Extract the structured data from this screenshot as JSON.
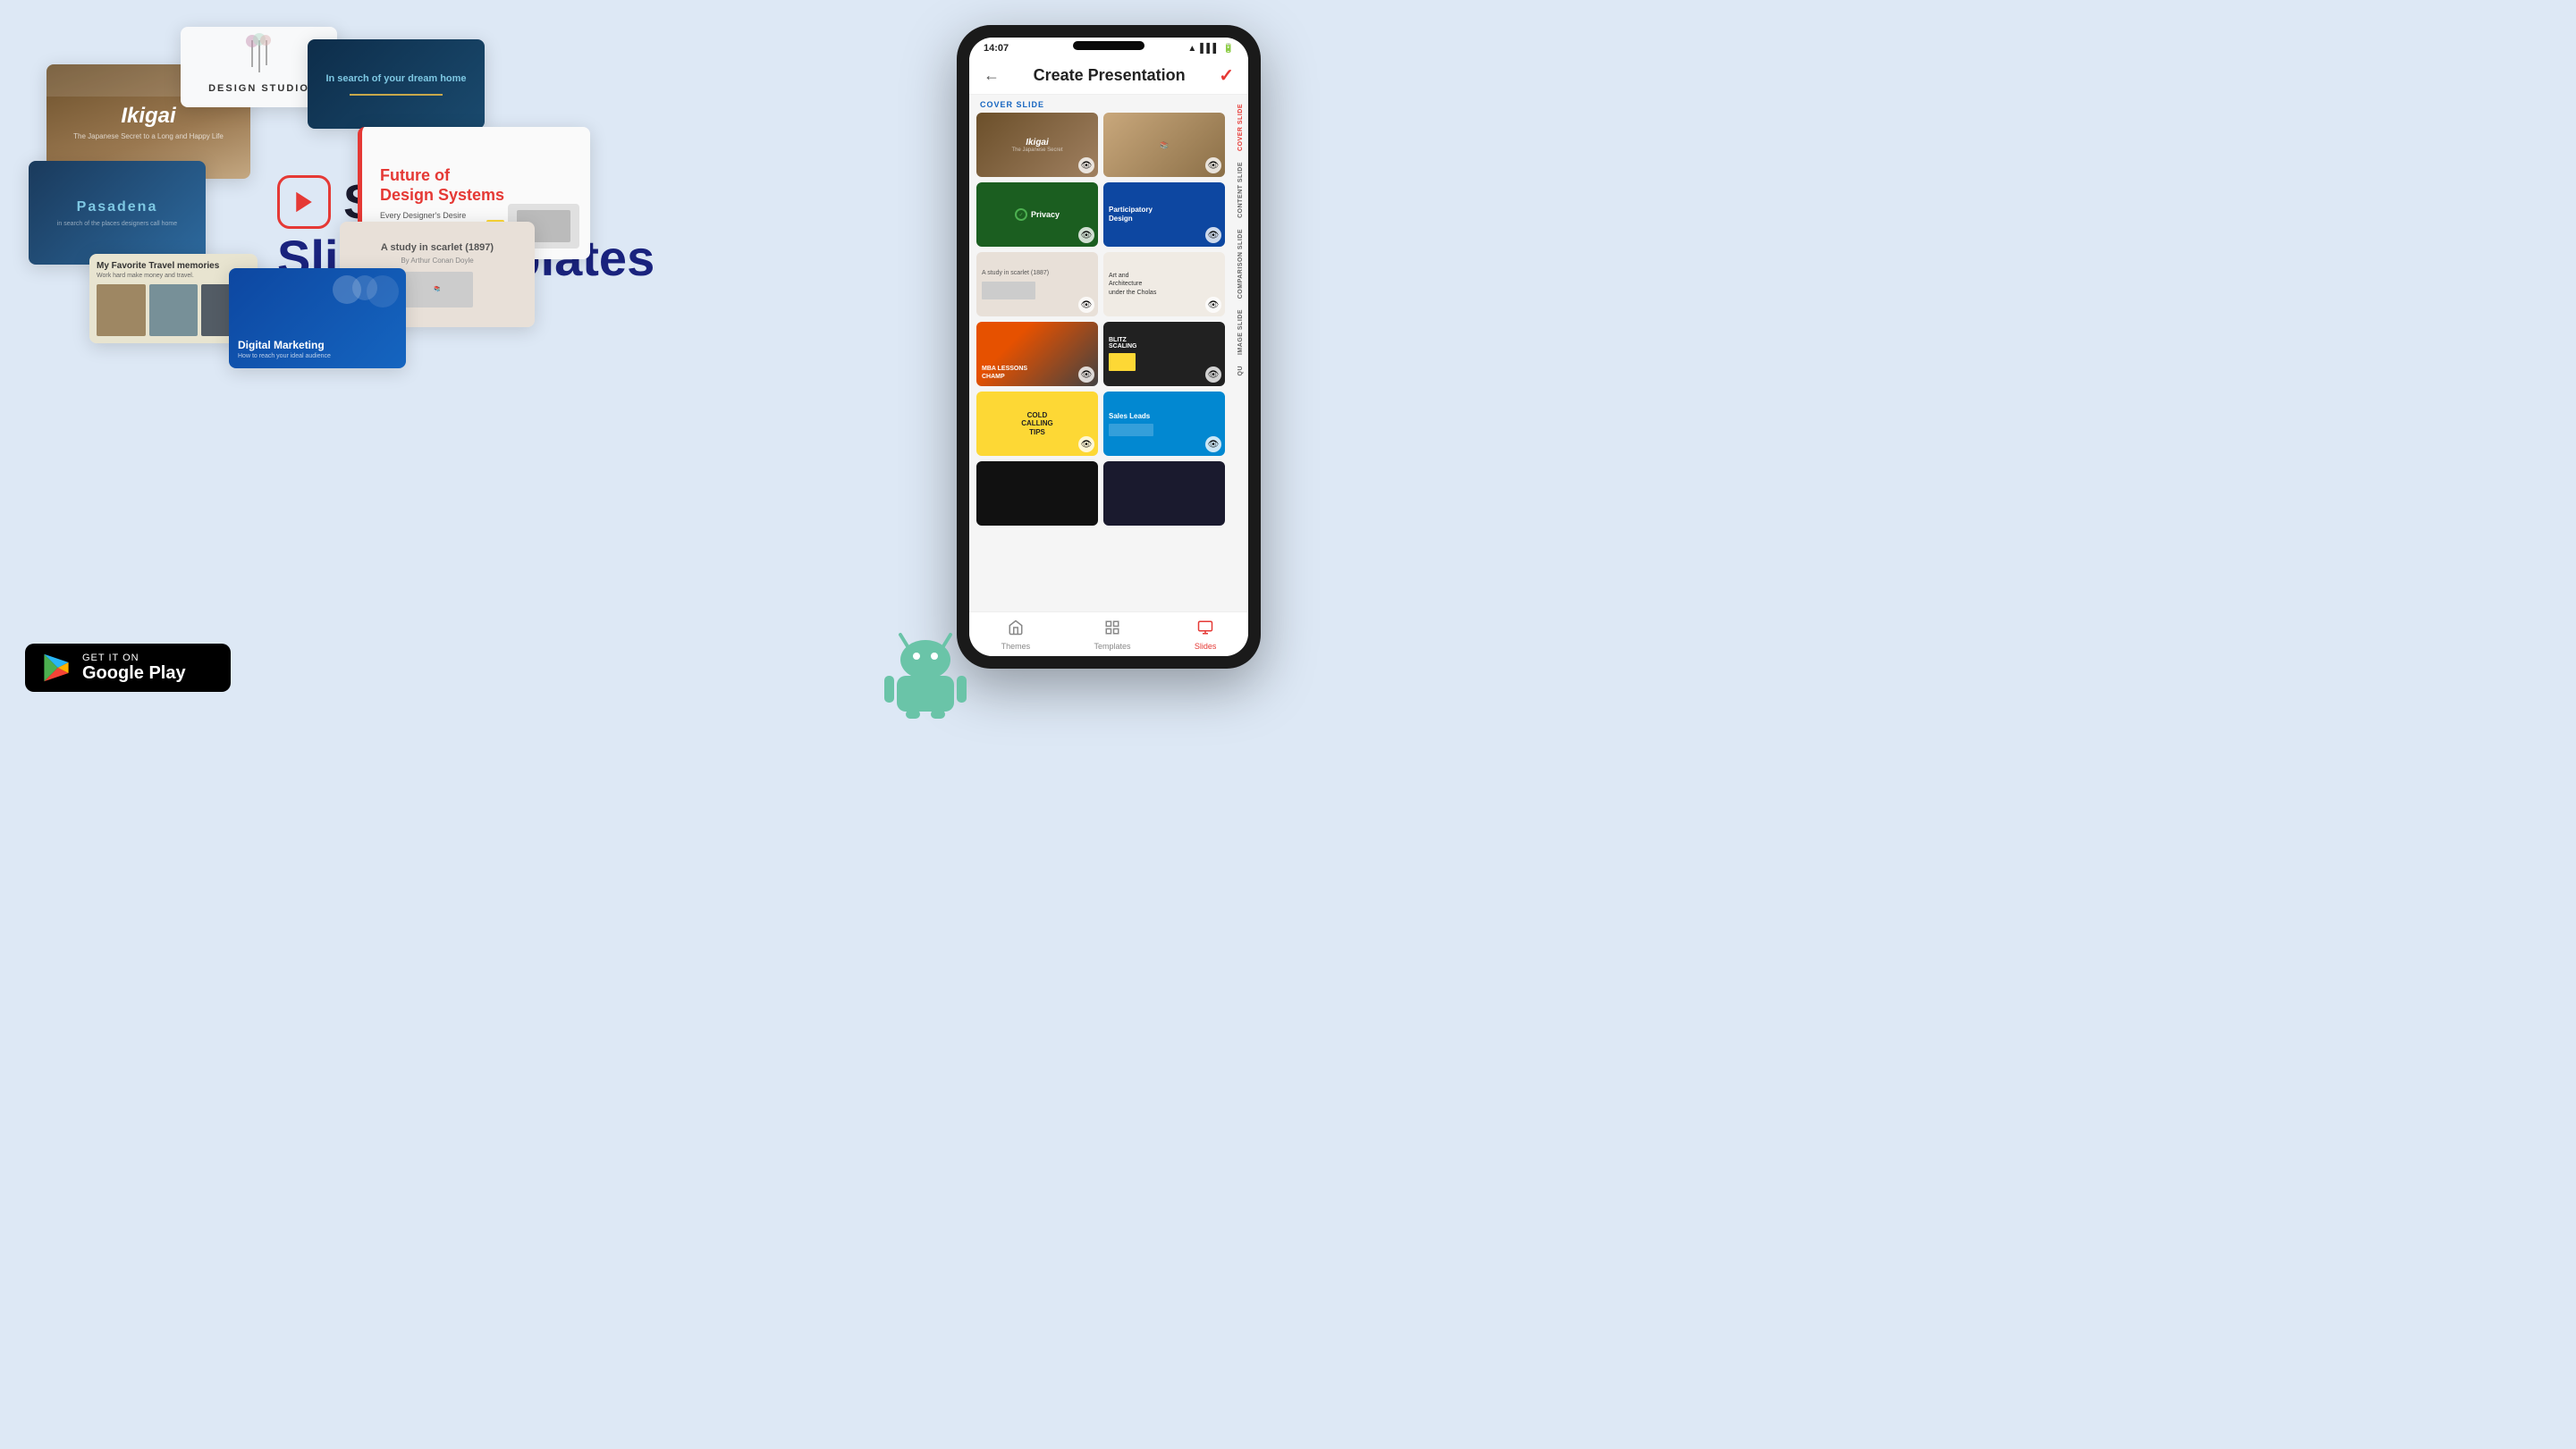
{
  "page": {
    "bg_color": "#dde8f5",
    "title": "Show Slide Templates"
  },
  "branding": {
    "app_name": "Show",
    "subtitle": "Slide Templates",
    "icon_label": "play-icon"
  },
  "google_play": {
    "get_it_on": "GET IT ON",
    "store_name": "Google Play"
  },
  "phone": {
    "time": "14:07",
    "header_title": "Create Presentation",
    "check_icon": "✓",
    "back_icon": "←",
    "sections": [
      {
        "label": "COVER SLIDE",
        "slides": [
          {
            "name": "ikigai",
            "type": "ikigai"
          },
          {
            "name": "books",
            "type": "books"
          }
        ]
      },
      {
        "label": "",
        "slides": [
          {
            "name": "privacy",
            "type": "privacy",
            "text": "Privacy"
          },
          {
            "name": "participatory",
            "type": "participatory",
            "text": "Participatory Design"
          }
        ]
      },
      {
        "label": "",
        "slides": [
          {
            "name": "study",
            "type": "study",
            "text": "A study in scarlet (1887)"
          },
          {
            "name": "artarch",
            "type": "artarch",
            "text": "Art and Architecture under the Cholas"
          }
        ]
      },
      {
        "label": "",
        "slides": [
          {
            "name": "basketball",
            "type": "basketball",
            "text": "MBA LESSONS CHAMP"
          },
          {
            "name": "blitz",
            "type": "blitz",
            "text": "BLITZ SCALING"
          }
        ]
      },
      {
        "label": "",
        "slides": [
          {
            "name": "coldtips",
            "type": "coldtips",
            "text": "COLD CALLING TIPS"
          },
          {
            "name": "salesleads",
            "type": "salesleads",
            "text": "Sales Leads"
          }
        ]
      },
      {
        "label": "",
        "slides": [
          {
            "name": "dark1",
            "type": "dark1"
          },
          {
            "name": "dark2",
            "type": "dark2"
          }
        ]
      }
    ],
    "right_tabs": [
      "COVER SLIDE",
      "CONTENT SLIDE",
      "COMPARISON SLIDE",
      "IMAGE SLIDE",
      "QU"
    ],
    "bottom_nav": [
      {
        "label": "Themes",
        "icon": "🎨",
        "active": false
      },
      {
        "label": "Templates",
        "icon": "📋",
        "active": false
      },
      {
        "label": "Slides",
        "icon": "▶",
        "active": true
      }
    ]
  },
  "floating_slides": {
    "ikigai": {
      "title": "Ikigai",
      "subtitle": "The Japanese Secret to a Long and Happy Life"
    },
    "design_studio": {
      "title": "DESIGN STUDIO"
    },
    "dream_home": {
      "title": "In search of your dream home"
    },
    "pasadena": {
      "title": "Pasadena"
    },
    "future_design": {
      "title": "Future of Design Systems",
      "subtitle": "Every Designer's Desire"
    },
    "travel": {
      "title": "My Favorite Travel memories",
      "subtitle": "Work hard make money and travel."
    },
    "study_scarlet": {
      "title": "A study in scarlet (1897)",
      "subtitle": "By Arthur Conan Doyle"
    },
    "digital_marketing": {
      "title": "Digital Marketing",
      "subtitle": "How to reach your ideal audience"
    }
  }
}
